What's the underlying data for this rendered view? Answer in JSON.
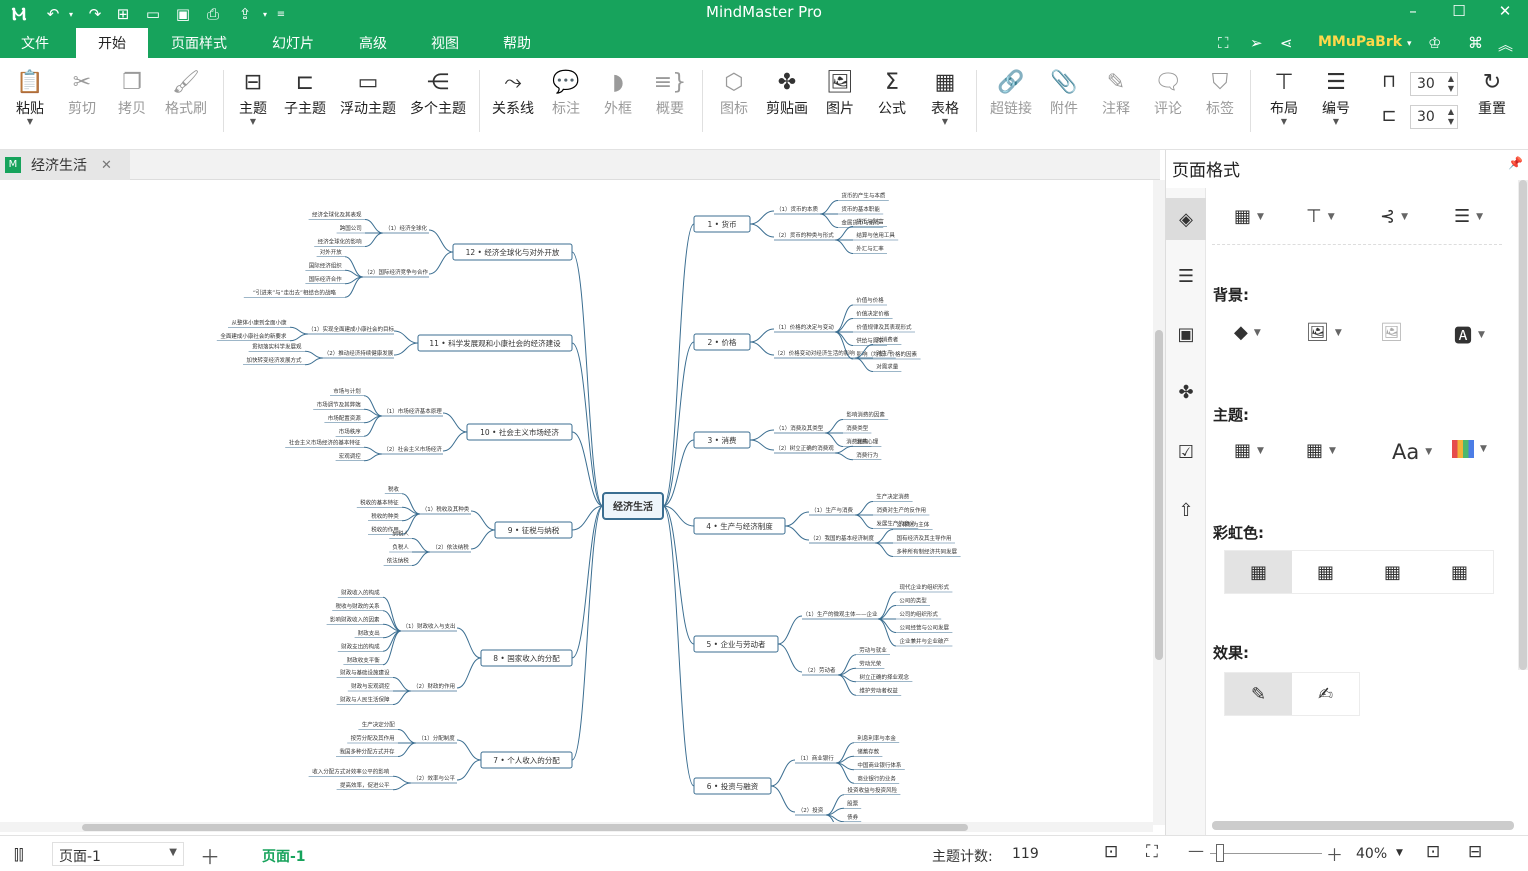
{
  "app": {
    "title": "MindMaster Pro",
    "user": "MMuPaBrk",
    "accent_color": "#17a35c"
  },
  "menu": {
    "items": [
      "文件",
      "开始",
      "页面样式",
      "幻灯片",
      "高级",
      "视图",
      "帮助"
    ],
    "active": "开始"
  },
  "ribbon": {
    "paste": "粘贴",
    "cut": "剪切",
    "copy": "拷贝",
    "format_painter": "格式刷",
    "topic": "主题",
    "subtopic": "子主题",
    "floating_topic": "浮动主题",
    "multiple_topics": "多个主题",
    "relationship": "关系线",
    "callout": "标注",
    "boundary": "外框",
    "summary": "概要",
    "icon": "图标",
    "clipart": "剪贴画",
    "picture": "图片",
    "formula": "公式",
    "table": "表格",
    "hyperlink": "超链接",
    "attachment": "附件",
    "note": "注释",
    "comment": "评论",
    "tag": "标签",
    "layout": "布局",
    "numbering": "编号",
    "spacing_h": "30",
    "spacing_v": "30",
    "reset": "重置"
  },
  "document_tab": {
    "name": "经济生活"
  },
  "mindmap": {
    "central": "经济生活",
    "right": [
      {
        "label": "1 • 货币",
        "subs": [
          {
            "label": "（1）货币的本质",
            "leaves": [
              "货币的产生与本质",
              "货币的基本职能",
              "金属货币与纸币"
            ]
          },
          {
            "label": "（2）货币的种类与形式",
            "leaves": [
              "货币与财富",
              "结算与信用工具",
              "外汇与汇率"
            ]
          }
        ]
      },
      {
        "label": "2 • 价格",
        "subs": [
          {
            "label": "（1）价格的决定与变动",
            "leaves": [
              "价值与价格",
              "价值决定价格",
              "价值规律及其表现形式",
              "供给与需求",
              "影响（均衡）价格的因素"
            ]
          },
          {
            "label": "（2）价格变动对经济生活的影响",
            "leaves": [
              "对消费者",
              "对生产",
              "对需求量"
            ]
          }
        ]
      },
      {
        "label": "3 • 消费",
        "subs": [
          {
            "label": "（1）消费及其类型",
            "leaves": [
              "影响消费的因素",
              "消费类型",
              "消费结构"
            ]
          },
          {
            "label": "（2）树立正确的消费观",
            "leaves": [
              "消费心理",
              "消费行为"
            ]
          }
        ]
      },
      {
        "label": "4 • 生产与经济制度",
        "subs": [
          {
            "label": "（1）生产与消费",
            "leaves": [
              "生产决定消费",
              "消费对生产的反作用",
              "发展生产的意义"
            ]
          },
          {
            "label": "（2）我国的基本经济制度",
            "leaves": [
              "公有制为主体",
              "国有经济及其主导作用",
              "多种所有制经济共同发展"
            ]
          }
        ]
      },
      {
        "label": "5 • 企业与劳动者",
        "subs": [
          {
            "label": "（1）生产的微观主体——企业",
            "leaves": [
              "现代企业的组织形式",
              "公司的类型",
              "公司的组织形式",
              "公司经营与公司发展",
              "企业兼并与企业破产"
            ]
          },
          {
            "label": "（2）劳动者",
            "leaves": [
              "劳动与就业",
              "劳动光荣",
              "树立正确的择业观念",
              "维护劳动者权益"
            ]
          }
        ]
      },
      {
        "label": "6 • 投资与融资",
        "subs": [
          {
            "label": "（1）商业银行",
            "leaves": [
              "利息利率与本金",
              "储蓄存款",
              "中国商业银行体系",
              "商业银行的业务"
            ]
          },
          {
            "label": "（2）投资",
            "leaves": [
              "投资收益与投资风险",
              "股票",
              "债券",
              "商业保险"
            ]
          }
        ]
      }
    ],
    "left": [
      {
        "label": "12 • 经济全球化与对外开放",
        "subs": [
          {
            "label": "（1）经济全球化",
            "leaves": [
              "经济全球化及其表现",
              "跨国公司",
              "经济全球化的影响"
            ]
          },
          {
            "label": "（2）国际经济竞争与合作",
            "leaves": [
              "对外开放",
              "国际经济组织",
              "国际经济合作",
              "“引进来”与“走出去”相结合的战略"
            ]
          }
        ]
      },
      {
        "label": "11 • 科学发展观和小康社会的经济建设",
        "subs": [
          {
            "label": "（1）实现全面建成小康社会的目标",
            "leaves": [
              "从整体小康到全面小康",
              "全面建成小康社会的新要求"
            ]
          },
          {
            "label": "（2）推动经济持续健康发展",
            "leaves": [
              "贯彻落实科学发展观",
              "加快转变经济发展方式"
            ]
          }
        ]
      },
      {
        "label": "10 • 社会主义市场经济",
        "subs": [
          {
            "label": "（1）市场经济基本原理",
            "leaves": [
              "市场与计划",
              "市场调节及其弊端",
              "市场配置资源",
              "市场秩序"
            ]
          },
          {
            "label": "（2）社会主义市场经济",
            "leaves": [
              "社会主义市场经济的基本特征",
              "宏观调控"
            ]
          }
        ]
      },
      {
        "label": "9 • 征税与纳税",
        "subs": [
          {
            "label": "（1）税收及其种类",
            "leaves": [
              "税收",
              "税收的基本特征",
              "税收的种类",
              "税收的作用"
            ]
          },
          {
            "label": "（2）依法纳税",
            "leaves": [
              "纳税人",
              "负税人",
              "依法纳税"
            ]
          }
        ]
      },
      {
        "label": "8 • 国家收入的分配",
        "subs": [
          {
            "label": "（1）财政收入与支出",
            "leaves": [
              "财政收入的构成",
              "税收与财政的关系",
              "影响财政收入的因素",
              "财政支出",
              "财政支出的构成",
              "财政收支平衡"
            ]
          },
          {
            "label": "（2）财政的作用",
            "leaves": [
              "财政与基础设施建设",
              "财政与宏观调控",
              "财政与人民生活保障"
            ]
          }
        ]
      },
      {
        "label": "7 • 个人收入的分配",
        "subs": [
          {
            "label": "（1）分配制度",
            "leaves": [
              "生产决定分配",
              "按劳分配及其作用",
              "我国多种分配方式并存"
            ]
          },
          {
            "label": "（2）效率与公平",
            "leaves": [
              "收入分配方式对效率公平的影响",
              "提高效率，促进公平"
            ]
          }
        ]
      }
    ]
  },
  "panel": {
    "title": "页面格式",
    "background": "背景:",
    "theme": "主题:",
    "rainbow": "彩虹色:",
    "effects": "效果:"
  },
  "status": {
    "page_select": "页面-1",
    "page_tab": "页面-1",
    "topic_count_label": "主题计数:",
    "topic_count": "119",
    "zoom": "40%"
  }
}
